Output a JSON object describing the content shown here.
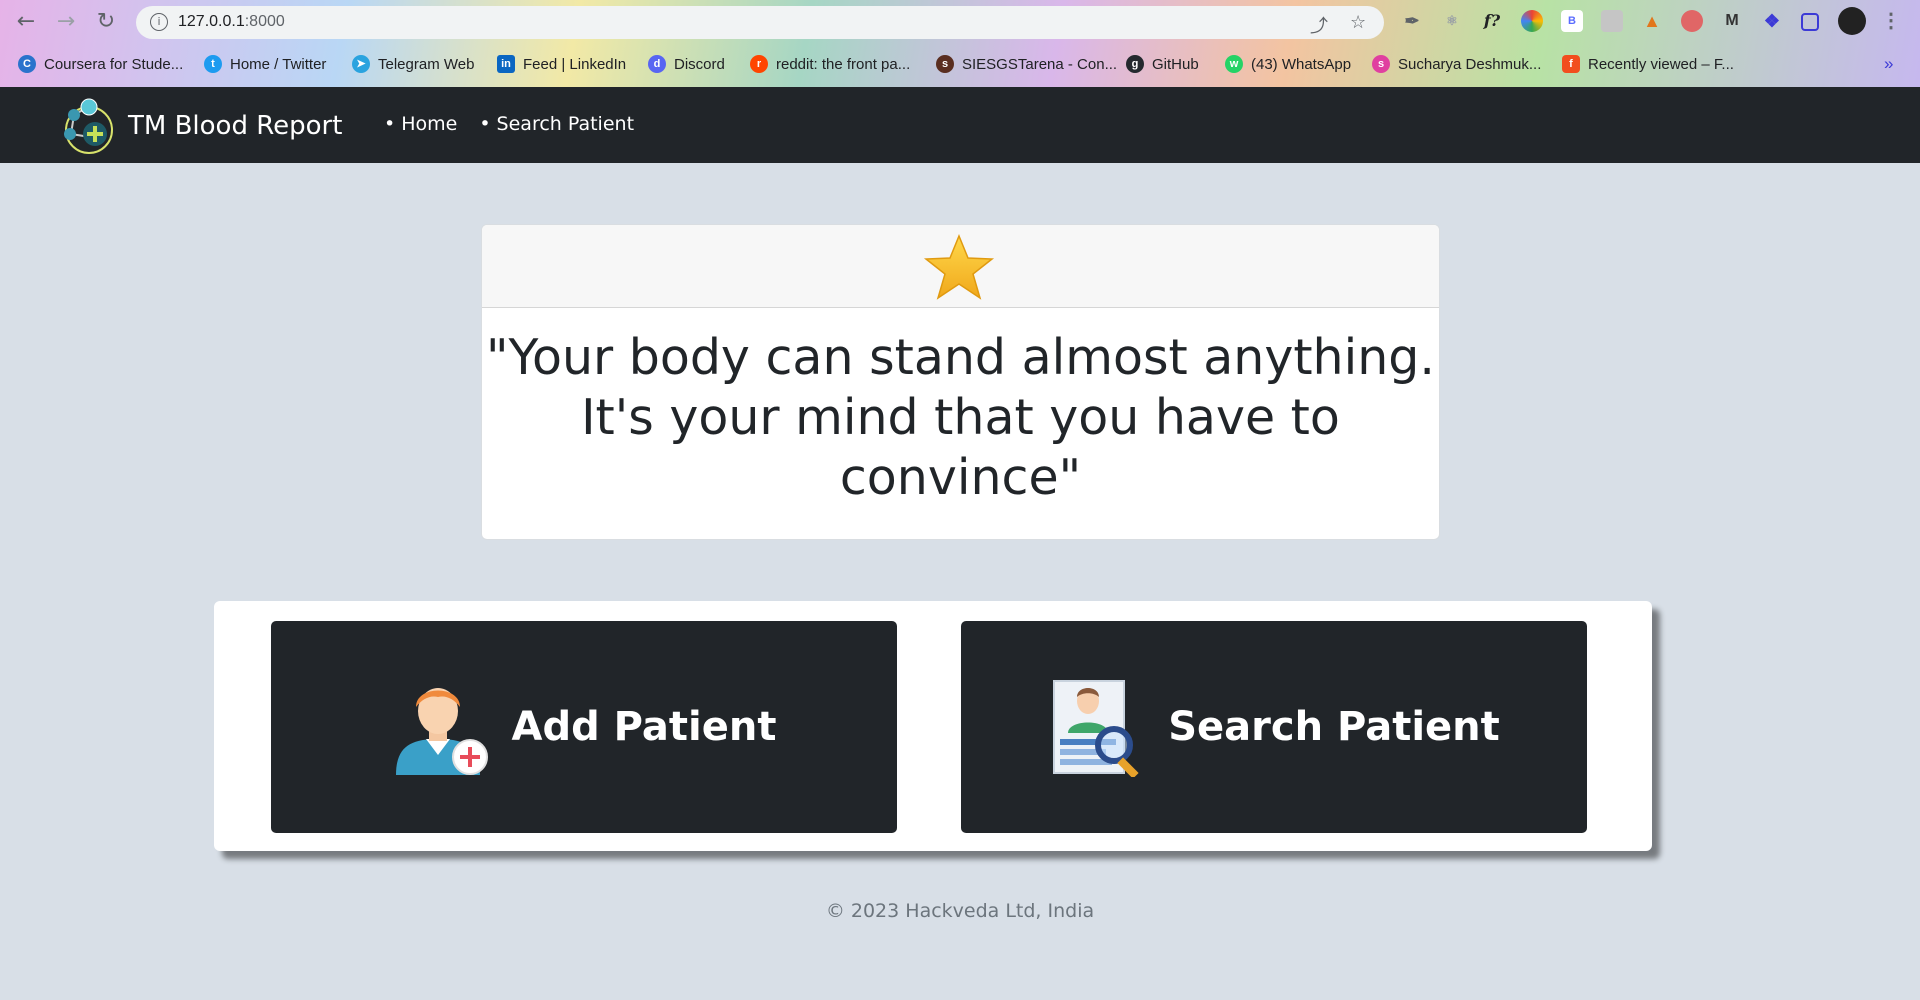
{
  "browser": {
    "url_host": "127.0.0.1",
    "url_port": ":8000",
    "bookmarks": [
      {
        "label": "Coursera for Stude...",
        "icon": "coursera-icon",
        "color": "#2a73cc"
      },
      {
        "label": "Home / Twitter",
        "icon": "twitter-icon",
        "color": "#1d9bf0"
      },
      {
        "label": "Telegram Web",
        "icon": "telegram-icon",
        "color": "#2aa3df"
      },
      {
        "label": "Feed | LinkedIn",
        "icon": "linkedin-icon",
        "color": "#0a66c2"
      },
      {
        "label": "Discord",
        "icon": "discord-icon",
        "color": "#5865f2"
      },
      {
        "label": "reddit: the front pa...",
        "icon": "reddit-icon",
        "color": "#ff4500"
      },
      {
        "label": "SIESGSTarena - Con...",
        "icon": "siesgst-icon",
        "color": "#5a2e20"
      },
      {
        "label": "GitHub",
        "icon": "github-icon",
        "color": "#24292e"
      },
      {
        "label": "(43) WhatsApp",
        "icon": "whatsapp-icon",
        "color": "#25d366"
      },
      {
        "label": "Sucharya Deshmuk...",
        "icon": "profile-link-icon",
        "color": "#e040a0"
      },
      {
        "label": "Recently viewed – F...",
        "icon": "figma-icon",
        "color": "#f24e1e"
      }
    ],
    "more_bookmarks": "»"
  },
  "app": {
    "brand": "TM Blood Report",
    "nav": {
      "home": "Home",
      "search": "Search Patient"
    }
  },
  "quote": {
    "text": "\"Your body can stand almost anything. It's your mind that you have to convince\""
  },
  "actions": {
    "add_patient": "Add Patient",
    "search_patient": "Search Patient"
  },
  "footer": {
    "text": "© 2023 Hackveda Ltd, India"
  },
  "colors": {
    "navbar": "#212529",
    "page_bg": "#d8dfe7",
    "star": "#f5b921"
  }
}
